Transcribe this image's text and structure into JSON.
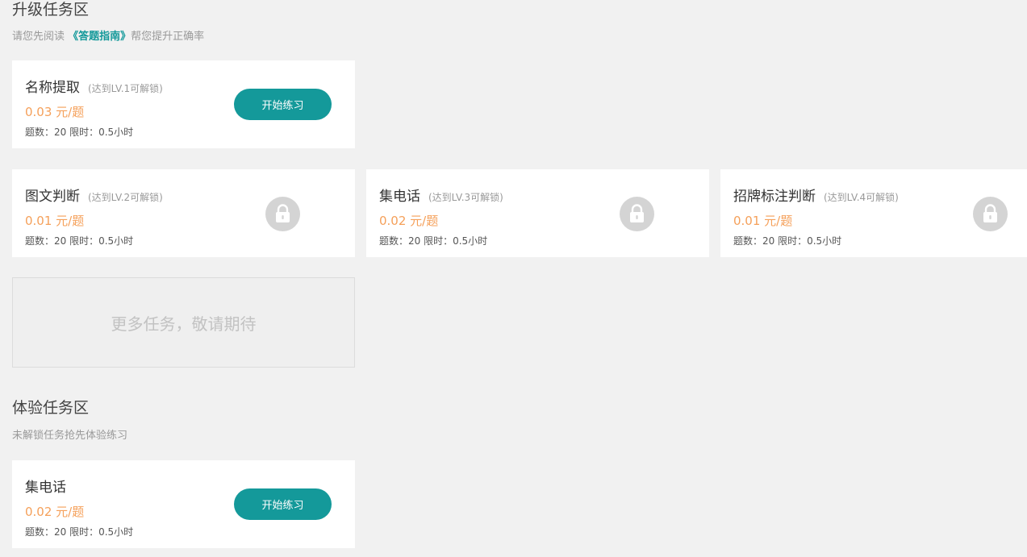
{
  "upgrade": {
    "title": "升级任务区",
    "subtitle_prefix": "请您先阅读",
    "guide_link": "《答题指南》",
    "subtitle_suffix": "帮您提升正确率",
    "tasks": [
      {
        "name": "名称提取",
        "requirement": "(达到LV.1可解锁)",
        "price": "0.03 元/题",
        "meta": "题数：20 限时：0.5小时",
        "state": "unlocked",
        "button": "开始练习"
      },
      {
        "name": "图文判断",
        "requirement": "(达到LV.2可解锁)",
        "price": "0.01 元/题",
        "meta": "题数：20 限时：0.5小时",
        "state": "locked",
        "icon": "lock-icon"
      },
      {
        "name": "集电话",
        "requirement": "(达到LV.3可解锁)",
        "price": "0.02 元/题",
        "meta": "题数：20 限时：0.5小时",
        "state": "locked",
        "icon": "lock-icon"
      },
      {
        "name": "招牌标注判断",
        "requirement": "(达到LV.4可解锁)",
        "price": "0.01 元/题",
        "meta": "题数：20 限时：0.5小时",
        "state": "locked",
        "icon": "lock-icon"
      }
    ],
    "more_placeholder": "更多任务，敬请期待"
  },
  "trial": {
    "title": "体验任务区",
    "subtitle": "未解锁任务抢先体验练习",
    "tasks": [
      {
        "name": "集电话",
        "price": "0.02 元/题",
        "meta": "题数：20 限时：0.5小时",
        "button": "开始练习"
      }
    ]
  },
  "colors": {
    "accent": "#14999a",
    "price": "#f5a05a",
    "background": "#f1f1f1",
    "lock": "#d4d4d4"
  }
}
